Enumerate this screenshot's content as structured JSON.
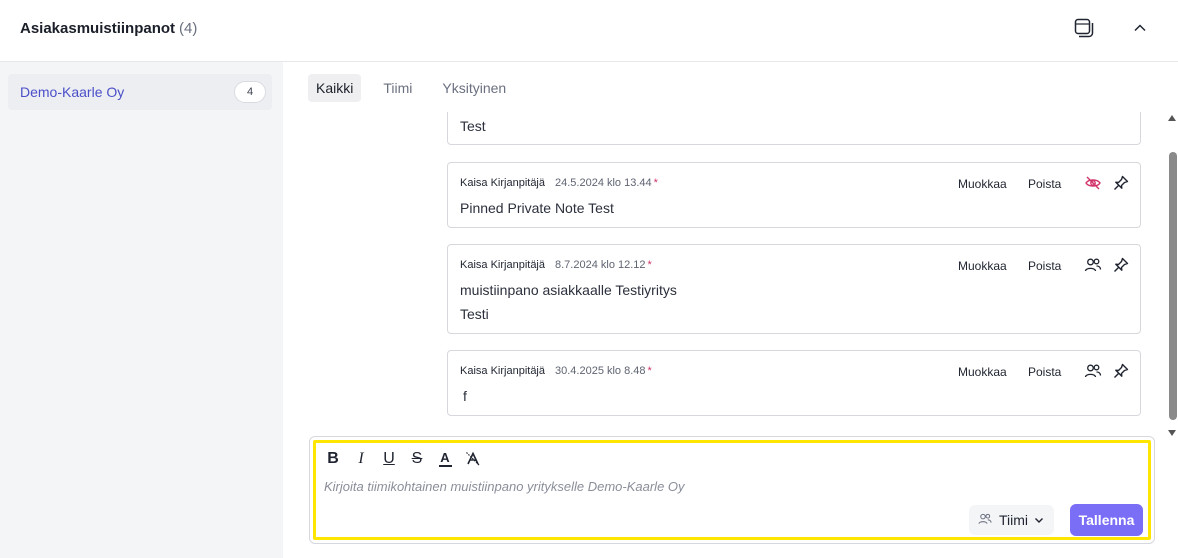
{
  "header": {
    "title": "Asiakasmuistiinpanot",
    "count": "(4)",
    "icons": [
      "copy-window-icon",
      "chevron-up-icon"
    ]
  },
  "sidebar": {
    "company": {
      "name": "Demo-Kaarle Oy",
      "count": "4"
    }
  },
  "tabs": [
    {
      "label": "Kaikki",
      "active": true
    },
    {
      "label": "Tiimi",
      "active": false
    },
    {
      "label": "Yksityinen",
      "active": false
    }
  ],
  "notes": [
    {
      "lines": [
        "Test"
      ]
    },
    {
      "author": "Kaisa Kirjanpitäjä",
      "date": "24.5.2024 klo 13.44",
      "star": "*",
      "edit_label": "Muokkaa",
      "delete_label": "Poista",
      "visibility_icon": "eye-off-icon",
      "lines": [
        "Pinned Private Note Test"
      ]
    },
    {
      "author": "Kaisa Kirjanpitäjä",
      "date": "8.7.2024 klo 12.12",
      "star": "*",
      "edit_label": "Muokkaa",
      "delete_label": "Poista",
      "visibility_icon": "team-icon",
      "lines": [
        "muistiinpano asiakkaalle Testiyritys",
        "Testi"
      ]
    },
    {
      "author": "Kaisa Kirjanpitäjä",
      "date": "30.4.2025 klo 8.48",
      "star": "*",
      "edit_label": "Muokkaa",
      "delete_label": "Poista",
      "visibility_icon": "team-icon",
      "lines": [
        "f"
      ]
    }
  ],
  "editor": {
    "toolbar": {
      "bold": "B",
      "italic": "I",
      "underline": "U",
      "strike": "S",
      "color": "A"
    },
    "placeholder": "Kirjoita tiimikohtainen muistiinpano yritykselle Demo-Kaarle Oy",
    "visibility_select": "Tiimi",
    "save_label": "Tallenna"
  },
  "colors": {
    "accent": "#7b6ef6",
    "link": "#4b4fc8",
    "highlight": "#ffe600",
    "danger": "#d0346b"
  }
}
